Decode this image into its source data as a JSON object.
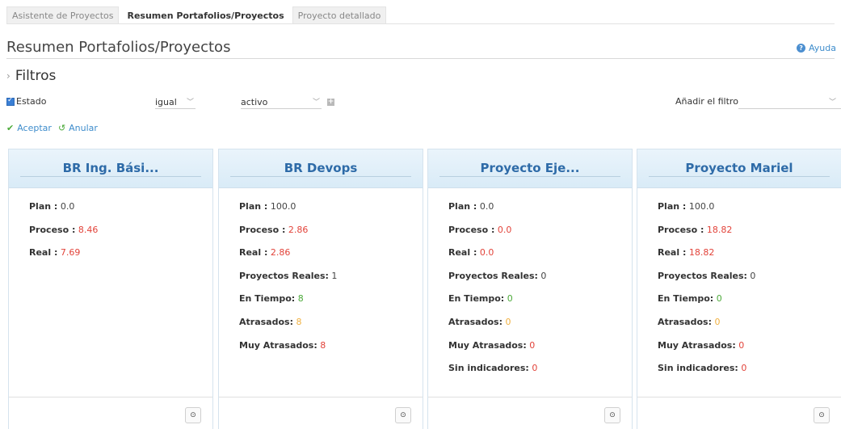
{
  "tabs": [
    {
      "label": "Asistente de Proyectos",
      "active": false
    },
    {
      "label": "Resumen Portafolios/Proyectos",
      "active": true
    },
    {
      "label": "Proyecto detallado",
      "active": false
    }
  ],
  "page": {
    "title": "Resumen Portafolios/Proyectos",
    "help_label": "Ayuda"
  },
  "filters": {
    "heading": "Filtros",
    "field_label": "Estado",
    "field_checked": true,
    "operator_value": "igual",
    "value_value": "activo",
    "add_filter_label": "Añadir el filtro",
    "add_filter_value": ""
  },
  "actions": {
    "accept_label": "Aceptar",
    "cancel_label": "Anular"
  },
  "colors": {
    "accent": "#2e6ba8",
    "red": "#e2433a",
    "green": "#4caa3a",
    "orange": "#f0b040",
    "link": "#3f8dcc"
  },
  "cards": [
    {
      "title": "BR Ing. Bási...",
      "rows": [
        {
          "label": "Plan :",
          "value": "0.0",
          "color": "plain"
        },
        {
          "label": "Proceso :",
          "value": "8.46",
          "color": "red"
        },
        {
          "label": "Real :",
          "value": "7.69",
          "color": "red"
        }
      ]
    },
    {
      "title": "BR Devops",
      "rows": [
        {
          "label": "Plan :",
          "value": "100.0",
          "color": "plain"
        },
        {
          "label": "Proceso :",
          "value": "2.86",
          "color": "red"
        },
        {
          "label": "Real :",
          "value": "2.86",
          "color": "red"
        },
        {
          "label": "Proyectos Reales:",
          "value": "1",
          "color": "plain"
        },
        {
          "label": "En Tiempo:",
          "value": "8",
          "color": "green"
        },
        {
          "label": "Atrasados:",
          "value": "8",
          "color": "orange"
        },
        {
          "label": "Muy Atrasados:",
          "value": "8",
          "color": "red"
        }
      ]
    },
    {
      "title": "Proyecto Eje...",
      "rows": [
        {
          "label": "Plan :",
          "value": "0.0",
          "color": "plain"
        },
        {
          "label": "Proceso :",
          "value": "0.0",
          "color": "red"
        },
        {
          "label": "Real :",
          "value": "0.0",
          "color": "red"
        },
        {
          "label": "Proyectos Reales:",
          "value": "0",
          "color": "plain"
        },
        {
          "label": "En Tiempo:",
          "value": "0",
          "color": "green"
        },
        {
          "label": "Atrasados:",
          "value": "0",
          "color": "orange"
        },
        {
          "label": "Muy Atrasados:",
          "value": "0",
          "color": "red"
        },
        {
          "label": "Sin indicadores:",
          "value": "0",
          "color": "red"
        }
      ]
    },
    {
      "title": "Proyecto Mariel",
      "rows": [
        {
          "label": "Plan :",
          "value": "100.0",
          "color": "plain"
        },
        {
          "label": "Proceso :",
          "value": "18.82",
          "color": "red"
        },
        {
          "label": "Real :",
          "value": "18.82",
          "color": "red"
        },
        {
          "label": "Proyectos Reales:",
          "value": "0",
          "color": "plain"
        },
        {
          "label": "En Tiempo:",
          "value": "0",
          "color": "green"
        },
        {
          "label": "Atrasados:",
          "value": "0",
          "color": "orange"
        },
        {
          "label": "Muy Atrasados:",
          "value": "0",
          "color": "red"
        },
        {
          "label": "Sin indicadores:",
          "value": "0",
          "color": "red"
        }
      ]
    }
  ]
}
